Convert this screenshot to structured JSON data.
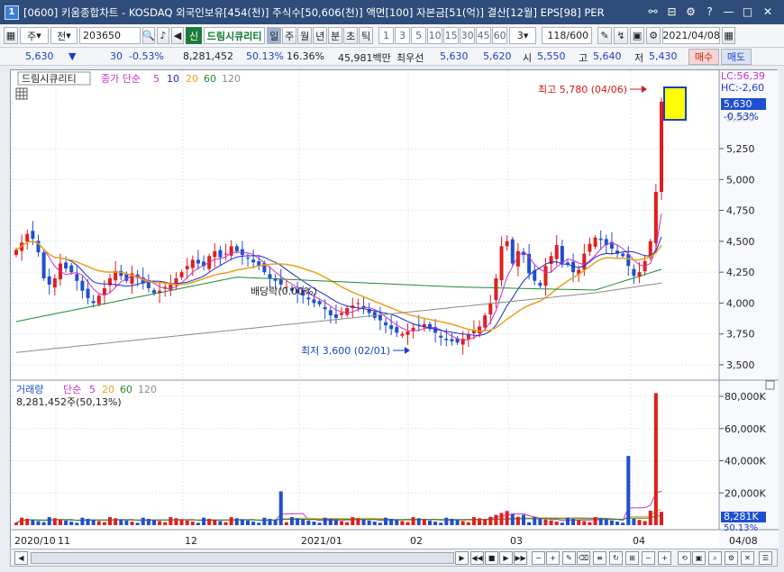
{
  "window": {
    "badge": "1",
    "title": "[0600] 키움종합차트 - KOSDAQ 외국인보유[454(천)] 주식수[50,606(천)] 액면[100] 자본금[51(억)] 결산[12월] EPS[98] PER"
  },
  "toolbar": {
    "type_btn": "주",
    "period_btn": "전",
    "code": "203650",
    "shin": "신",
    "name": "드림시큐리티",
    "periods": [
      "일",
      "주",
      "월",
      "년",
      "분",
      "초",
      "틱"
    ],
    "minutes": [
      "1",
      "3",
      "5",
      "10",
      "15",
      "30",
      "45",
      "60"
    ],
    "interval": "3",
    "count": "118/600",
    "date": "2021/04/08"
  },
  "quote": {
    "price": "5,630",
    "change": "30",
    "change_pct": "-0.53%",
    "volume": "8,281,452",
    "vol_ratio": "50.13%",
    "turnover": "16.36%",
    "amount": "45,981백만",
    "best_bid_label": "최우선",
    "best_ask": "5,630",
    "best_bid": "5,620",
    "open_label": "시",
    "open": "5,550",
    "high_label": "고",
    "high": "5,640",
    "low_label": "저",
    "low": "5,430",
    "buy": "매수",
    "sell": "매도"
  },
  "legend": {
    "stock_name": "드림시큐리티",
    "ma_prefix": "종가 단순",
    "ma5": "5",
    "ma10": "10",
    "ma20": "20",
    "ma60": "60",
    "ma120": "120"
  },
  "vol_legend": {
    "prefix": "거래량",
    "mode": "단순",
    "ma5": "5",
    "ma20": "20",
    "ma60": "60",
    "ma120": "120",
    "value": "8,281,452주(50,13%)"
  },
  "annotations": {
    "high": "최고 5,780 (04/06)",
    "low": "최저 3,600 (02/01)",
    "drop": "배당락(0.00%)",
    "lc": "LC:56,39",
    "hc": "HC:-2,60",
    "cur_price": "5,630",
    "cur_pct": "-0.53%",
    "vol_price": "8,281K",
    "vol_pct": "50.13%"
  },
  "price_axis": [
    "5,250",
    "5,000",
    "4,750",
    "4,500",
    "4,250",
    "4,000",
    "3,750",
    "3,500"
  ],
  "price_axis_top": "5,500",
  "vol_axis": [
    "80,000K",
    "60,000K",
    "40,000K",
    "20,000K"
  ],
  "date_axis": [
    "2020/10",
    "11",
    "12",
    "2021/01",
    "02",
    "03",
    "04",
    "04/08"
  ],
  "colors": {
    "up": "#e01e1e",
    "down": "#1f4fd1",
    "ma5": "#c832c8",
    "ma10": "#1a2cc8",
    "ma20": "#e8a11a",
    "ma60": "#1f8a2f",
    "ma120": "#8a8a8a"
  }
}
